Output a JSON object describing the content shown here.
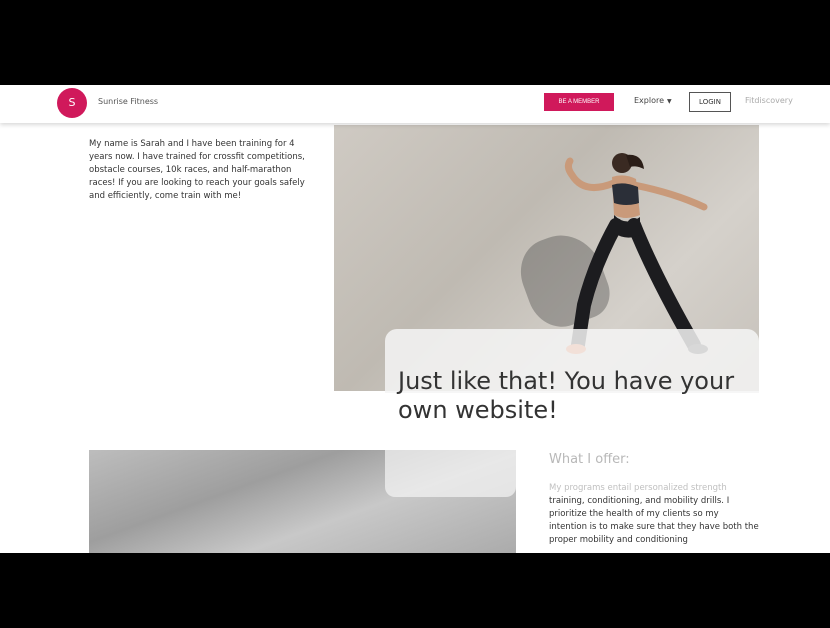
{
  "navbar": {
    "logo_letter": "S",
    "brand": "Sunrise Fitness",
    "cta_label": "BE A MEMBER",
    "explore_label": "Explore",
    "login_label": "LOGIN",
    "discovery_label": "Fitdiscovery",
    "accent_color": "#d0195b"
  },
  "about": {
    "text": "My name is Sarah and I have been training for 4 years now. I have trained for crossfit competitions, obstacle courses, 10k races, and half-marathon races! If you are looking to reach your goals safely and efficiently, come train with me!"
  },
  "hero": {
    "headline": "Just like that! You have your own website!"
  },
  "offer": {
    "title": "What I offer:",
    "text_faded": "My programs entail personalized strength",
    "text": "training, conditioning, and mobility drills. I prioritize the health of my clients so my intention is to make sure that they have both the proper mobility and conditioning"
  }
}
